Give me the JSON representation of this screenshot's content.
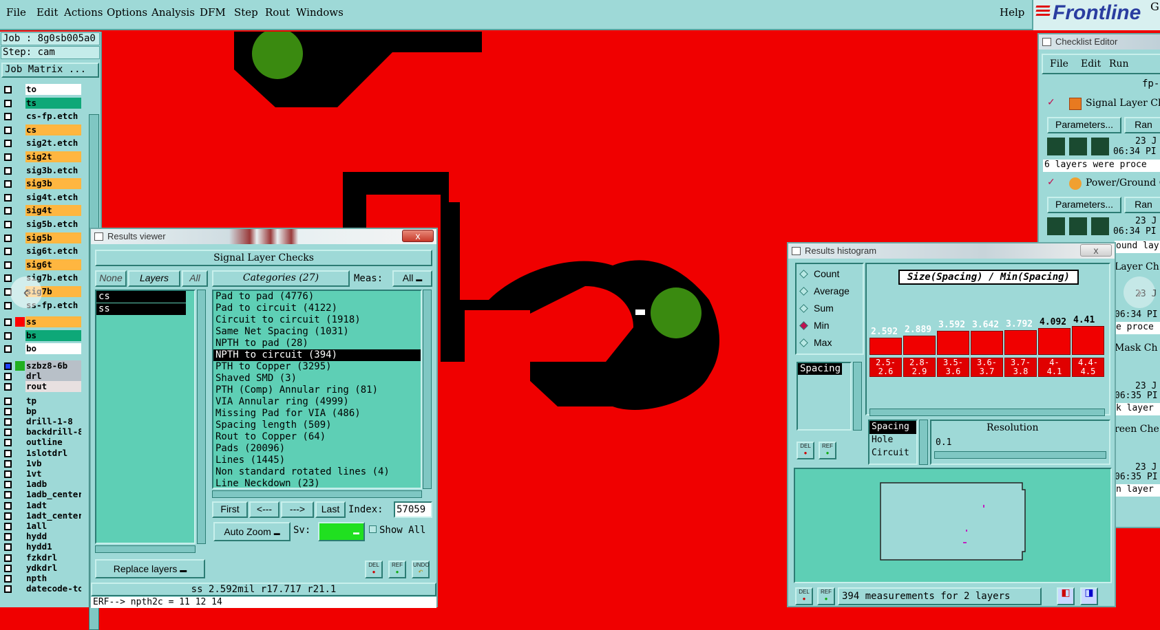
{
  "menu": [
    "File",
    "Edit",
    "Actions",
    "Options",
    "Analysis",
    "DFM",
    "Step",
    "Rout",
    "Windows"
  ],
  "help": "Help",
  "logo": "Frontline",
  "logo_edge": "G",
  "job": {
    "job_line": "Job : 8g0sb005a0",
    "step_line": "Step: cam",
    "matrix_button": "Job Matrix ..."
  },
  "layers": [
    {
      "name": "to",
      "color": "#ffffff"
    },
    {
      "name": "ts",
      "color": "#0ea878"
    },
    {
      "name": "cs-fp.etch",
      "color": "#9ed9d7"
    },
    {
      "name": "cs",
      "color": "#ffb640"
    },
    {
      "name": "sig2t.etch",
      "color": "#9ed9d7"
    },
    {
      "name": "sig2t",
      "color": "#ffb640"
    },
    {
      "name": "sig3b.etch",
      "color": "#9ed9d7"
    },
    {
      "name": "sig3b",
      "color": "#ffb640"
    },
    {
      "name": "sig4t.etch",
      "color": "#9ed9d7"
    },
    {
      "name": "sig4t",
      "color": "#ffb640"
    },
    {
      "name": "sig5b.etch",
      "color": "#9ed9d7"
    },
    {
      "name": "sig5b",
      "color": "#ffb640"
    },
    {
      "name": "sig6t.etch",
      "color": "#9ed9d7"
    },
    {
      "name": "sig6t",
      "color": "#ffb640"
    },
    {
      "name": "sig7b.etch",
      "color": "#9ed9d7"
    },
    {
      "name": "sig7b",
      "color": "#ffb640"
    },
    {
      "name": "ss-fp.etch",
      "color": "#9ed9d7"
    },
    {
      "name": "ss",
      "color": "#ffb640"
    },
    {
      "name": "bs",
      "color": "#0ea878"
    },
    {
      "name": "bo",
      "color": "#ffffff"
    },
    {
      "name": "szbz8-6b",
      "color": "#b8c0c8"
    },
    {
      "name": "drl",
      "color": "#b8c0c8"
    },
    {
      "name": "rout",
      "color": "#e8e0e0"
    },
    {
      "name": "tp",
      "color": "#9ed9d7"
    },
    {
      "name": "bp",
      "color": "#9ed9d7"
    },
    {
      "name": "drill-1-8",
      "color": "#9ed9d7"
    },
    {
      "name": "backdrill-8-",
      "color": "#9ed9d7"
    },
    {
      "name": "outline",
      "color": "#9ed9d7"
    },
    {
      "name": "1slotdrl",
      "color": "#9ed9d7"
    },
    {
      "name": "1vb",
      "color": "#9ed9d7"
    },
    {
      "name": "1vt",
      "color": "#9ed9d7"
    },
    {
      "name": "1adb",
      "color": "#9ed9d7"
    },
    {
      "name": "1adb_center",
      "color": "#9ed9d7"
    },
    {
      "name": "1adt",
      "color": "#9ed9d7"
    },
    {
      "name": "1adt_center",
      "color": "#9ed9d7"
    },
    {
      "name": "1all",
      "color": "#9ed9d7"
    },
    {
      "name": "hydd",
      "color": "#9ed9d7"
    },
    {
      "name": "hydd1",
      "color": "#9ed9d7"
    },
    {
      "name": "fzkdrl",
      "color": "#9ed9d7"
    },
    {
      "name": "ydkdrl",
      "color": "#9ed9d7"
    },
    {
      "name": "npth",
      "color": "#9ed9d7"
    },
    {
      "name": "datecode-to",
      "color": "#9ed9d7"
    }
  ],
  "results_viewer": {
    "title": "Results viewer",
    "close": "x",
    "header": "Signal Layer Checks",
    "none": "None",
    "layers": "Layers",
    "all": "All",
    "categories": "Categories (27)",
    "meas_label": "Meas:",
    "meas_value": "All",
    "layer_list": [
      "cs",
      "ss"
    ],
    "category_list": [
      "Pad to pad (4776)",
      "Pad to circuit (4122)",
      "Circuit to circuit (1918)",
      "Same Net Spacing (1031)",
      "NPTH to pad (28)",
      "NPTH to circuit (394)",
      "PTH to Copper (3295)",
      "Shaved SMD (3)",
      "PTH (Comp) Annular ring (81)",
      "VIA Annular ring (4999)",
      "Missing Pad for VIA (486)",
      "Spacing length (509)",
      "Rout to Copper (64)",
      "Pads (20096)",
      "Lines (1445)",
      "Non standard rotated lines (4)",
      "Line Neckdown (23)"
    ],
    "selected_category": "NPTH to circuit (394)",
    "first": "First",
    "prev": "<---",
    "next": "--->",
    "last": "Last",
    "index_label": "Index:",
    "index_value": "57059",
    "auto_zoom": "Auto Zoom",
    "sv_label": "Sv:",
    "show_all": "Show All",
    "replace_layers": "Replace layers",
    "del": "DEL",
    "ref": "REF",
    "undo": "UNDO",
    "status": "ss 2.592mil  r17.717  r21.1",
    "erf": "ERF--> npth2c = 11 12 14"
  },
  "histogram": {
    "title": "Results histogram",
    "close": "x",
    "modes": [
      "Count",
      "Average",
      "Sum",
      "Min",
      "Max"
    ],
    "selected_mode": "Min",
    "mode_list": [
      "Spacing"
    ],
    "chart_title": "Size(Spacing) / Min(Spacing)",
    "bars": [
      {
        "label": "2.5-2.6",
        "value": 2.592
      },
      {
        "label": "2.8-2.9",
        "value": 2.889
      },
      {
        "label": "3.5-3.6",
        "value": 3.592
      },
      {
        "label": "3.6-3.7",
        "value": 3.642
      },
      {
        "label": "3.7-3.8",
        "value": 3.792
      },
      {
        "label": "4-4.1",
        "value": 4.092
      },
      {
        "label": "4.4-4.5",
        "value": 4.41
      }
    ],
    "value_labels": [
      "2.592",
      "2.889",
      "3.592",
      "3.642",
      "3.792",
      "4.092",
      "4.41"
    ],
    "cat_labels": [
      "2.5-\n2.6",
      "2.8-\n2.9",
      "3.5-\n3.6",
      "3.6-\n3.7",
      "3.7-\n3.8",
      "4-\n4.1",
      "4.4-\n4.5"
    ],
    "types": [
      "Spacing",
      "Hole",
      "Circuit"
    ],
    "resolution_label": "Resolution",
    "resolution_value": "0.1",
    "measurements": "394 measurements for 2 layers",
    "del": "DEL",
    "ref": "REF"
  },
  "checklist": {
    "title": "Checklist Editor",
    "menu": [
      "File",
      "Edit",
      "Run"
    ],
    "fp": "fp-",
    "item1": "Signal Layer Ch",
    "params": "Parameters...",
    "ran": "Ran",
    "date1": "23 J",
    "time1": "06:34 PI",
    "msg1": "6 layers were proce",
    "item2": "Power/Ground C",
    "date2": "23 J",
    "time2": "06:34 PI",
    "msg2": "ound lay",
    "item3": "Layer Ch",
    "date3": "23 J",
    "time3": "06:34 PI",
    "msg3": "e proce",
    "item4": "Mask Ch",
    "date4": "23 J",
    "time4": "06:35 PI",
    "msg4": "k layer",
    "item5": "reen Che",
    "date5": "23 J",
    "time5": "06:35 PI",
    "msg5": "n layer"
  },
  "colors": {
    "background": "#f00000",
    "panel": "#9ed9d7",
    "list": "#5ecfb5",
    "copper_void": "#000000",
    "pad": "#3a8a10"
  }
}
